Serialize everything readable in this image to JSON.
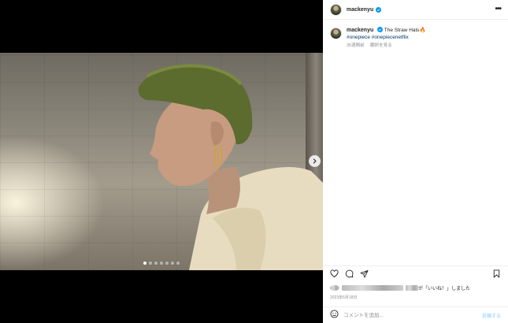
{
  "post": {
    "username": "mackenyu",
    "verified": true,
    "caption_text": "The Straw Hats🔥",
    "hashtags": "#onepiece #onepiecenetflix",
    "time_ago": "35週間前",
    "translate": "翻訳を見る",
    "likes_text": "が「いいね！」しました",
    "date": "2023年6月18日",
    "carousel": {
      "count": 7,
      "active_index": 0
    }
  },
  "header": {
    "more_label": "•••"
  },
  "comment": {
    "placeholder": "コメントを追加...",
    "post_label": "投稿する"
  },
  "icons": {
    "like": "heart-icon",
    "comment": "comment-icon",
    "share": "share-icon",
    "save": "bookmark-icon",
    "emoji": "emoji-icon",
    "next": "chevron-right-icon",
    "verified": "verified-badge-icon"
  },
  "colors": {
    "verified": "#0095f6",
    "hashtag": "#00376b",
    "muted": "#8e8e8e",
    "post_button": "#b2dffc"
  }
}
